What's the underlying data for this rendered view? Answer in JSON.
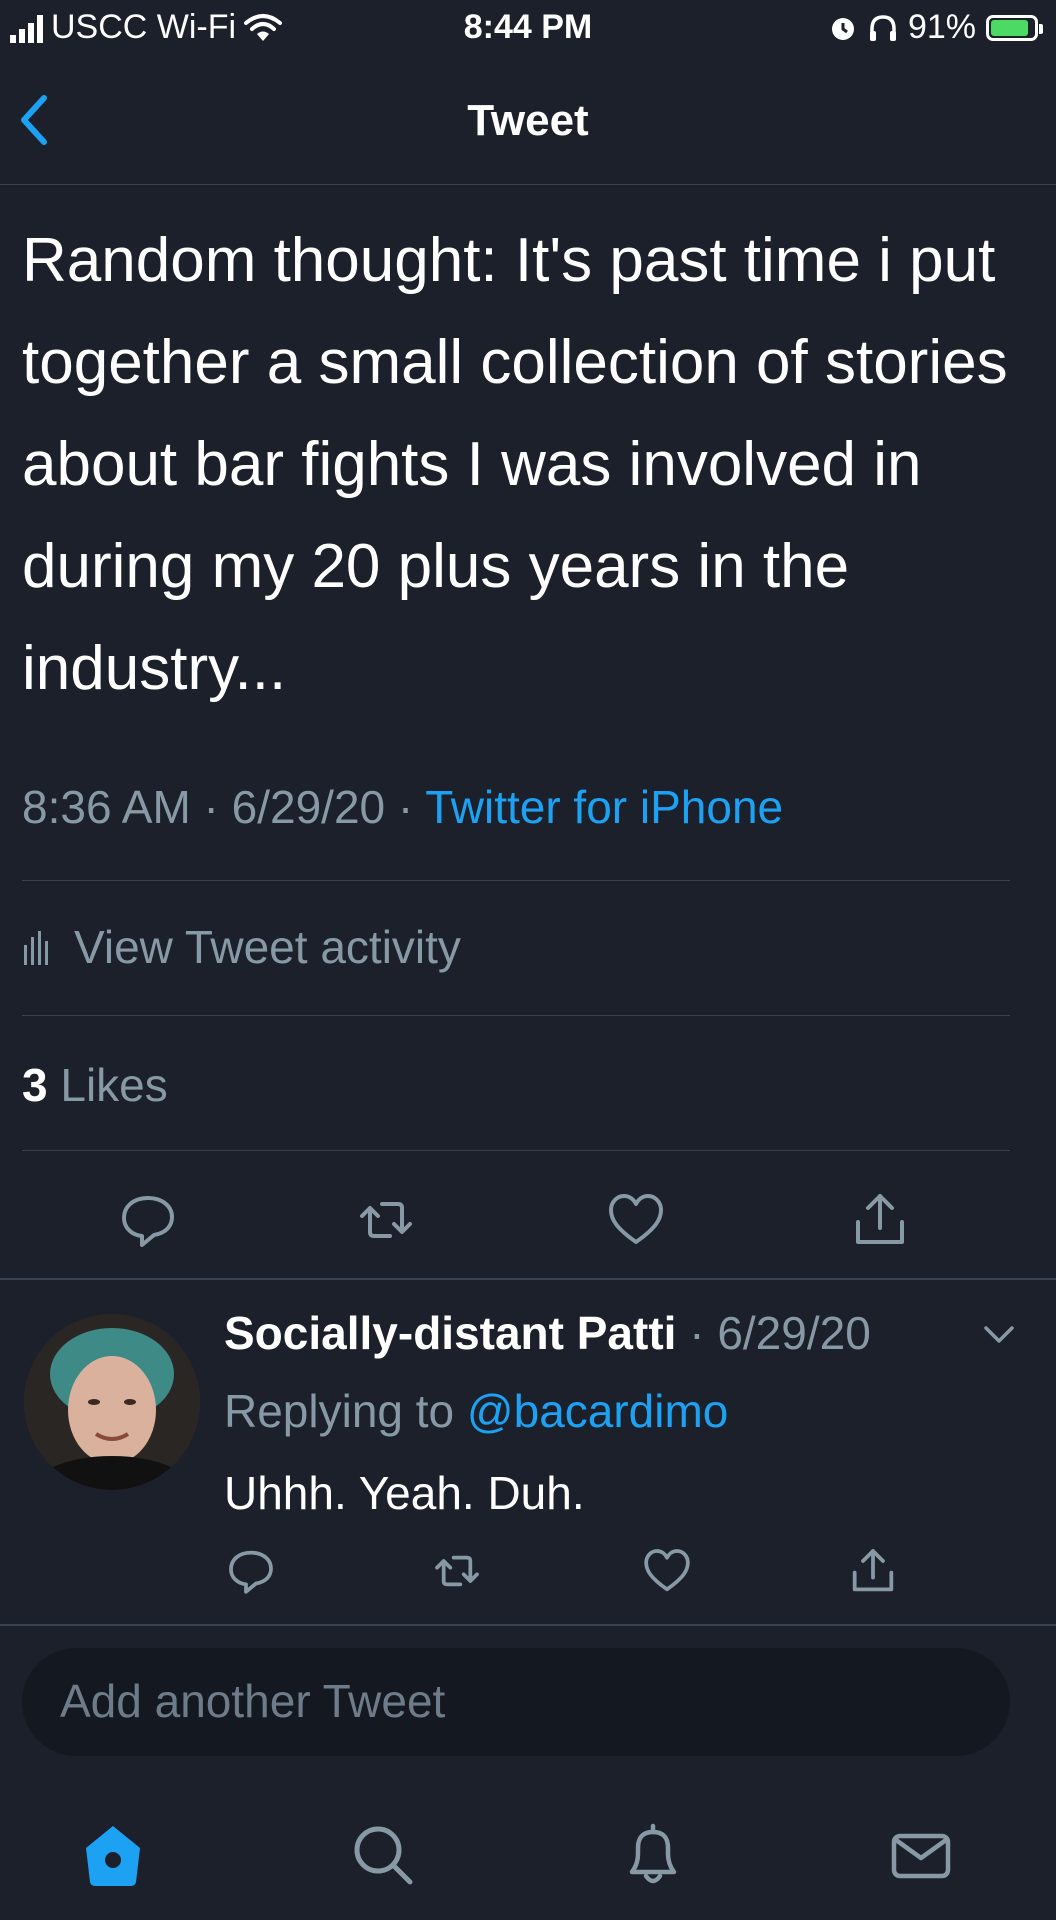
{
  "status_bar": {
    "carrier": "USCC Wi-Fi",
    "time": "8:44 PM",
    "battery": "91%"
  },
  "nav": {
    "title": "Tweet"
  },
  "tweet": {
    "text": "Random thought: It's past time i put together a small collection of stories about bar fights I was involved in during my 20 plus years in the industry...",
    "timestamp": "8:36 AM · 6/29/20 · ",
    "source": "Twitter for iPhone",
    "activity_label": "View Tweet activity",
    "likes_count": "3",
    "likes_label": " Likes"
  },
  "reply": {
    "author": "Socially-distant Patti",
    "date": " · 6/29/20",
    "replying_prefix": "Replying to ",
    "replying_handle": "@bacardimo",
    "text": "Uhhh. Yeah. Duh."
  },
  "compose": {
    "placeholder": "Add another Tweet"
  },
  "colors": {
    "background": "#1b202b",
    "accent": "#1da1f2",
    "muted": "#8899a6"
  }
}
